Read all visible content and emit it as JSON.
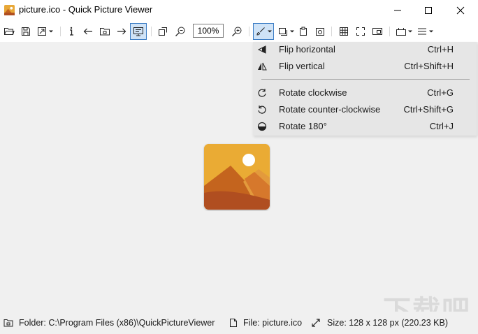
{
  "window": {
    "title": "picture.ico - Quick Picture Viewer",
    "minimize_icon": "minimize-icon",
    "maximize_icon": "maximize-icon",
    "close_icon": "close-icon"
  },
  "toolbar": {
    "zoom_value": "100%",
    "active_tool": "slideshow-view"
  },
  "rotate_menu": {
    "items": [
      {
        "icon": "flip-horizontal-icon",
        "label": "Flip horizontal",
        "shortcut": "Ctrl+H"
      },
      {
        "icon": "flip-vertical-icon",
        "label": "Flip vertical",
        "shortcut": "Ctrl+Shift+H"
      },
      {
        "icon": "rotate-clockwise-icon",
        "label": "Rotate clockwise",
        "shortcut": "Ctrl+G"
      },
      {
        "icon": "rotate-counter-clockwise-icon",
        "label": "Rotate counter-clockwise",
        "shortcut": "Ctrl+Shift+G"
      },
      {
        "icon": "rotate-180-icon",
        "label": "Rotate 180°",
        "shortcut": "Ctrl+J"
      }
    ]
  },
  "statusbar": {
    "folder": "Folder: C:\\Program Files (x86)\\QuickPictureViewer",
    "file": "File: picture.ico",
    "size": "Size: 128 x 128 px (220.23 KB)"
  },
  "watermark": "下载吧",
  "colors": {
    "accent": "#3b7cc4",
    "menu_bg": "#e6e6e6",
    "canvas_bg": "#f0f0f0",
    "picture_sky": "#e8a838",
    "picture_sun": "#ffffff",
    "picture_mountain": "#c4641e",
    "picture_ground": "#b04e20"
  }
}
